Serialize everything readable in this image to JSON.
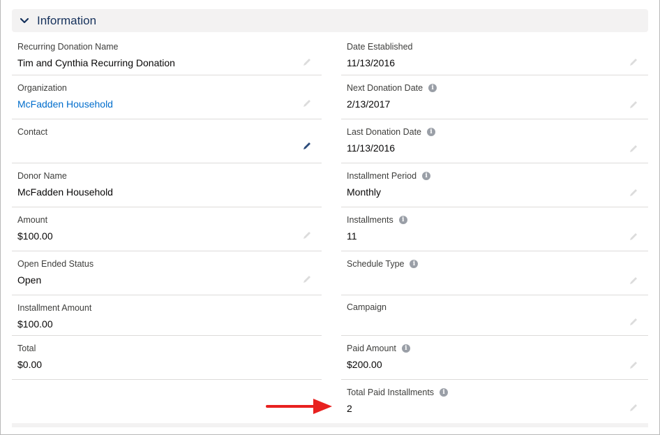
{
  "section": {
    "title": "Information",
    "icon": "chevron-down-icon"
  },
  "left_fields": [
    {
      "label": "Recurring Donation Name",
      "value": "Tim and Cynthia Recurring Donation",
      "link": false
    },
    {
      "label": "Organization",
      "value": "McFadden Household",
      "link": true
    },
    {
      "label": "Contact",
      "value": "",
      "link": false
    },
    {
      "label": "Donor Name",
      "value": "McFadden Household",
      "link": false
    },
    {
      "label": "Amount",
      "value": "$100.00",
      "link": false
    },
    {
      "label": "Open Ended Status",
      "value": "Open",
      "link": false
    },
    {
      "label": "Installment Amount",
      "value": "$100.00",
      "link": false
    },
    {
      "label": "Total",
      "value": "$0.00",
      "link": false
    }
  ],
  "right_fields": [
    {
      "label": "Date Established",
      "value": "11/13/2016",
      "info": false
    },
    {
      "label": "Next Donation Date",
      "value": "2/13/2017",
      "info": true
    },
    {
      "label": "Last Donation Date",
      "value": "11/13/2016",
      "info": true
    },
    {
      "label": "Installment Period",
      "value": "Monthly",
      "info": true
    },
    {
      "label": "Installments",
      "value": "11",
      "info": true
    },
    {
      "label": "Schedule Type",
      "value": "",
      "info": true
    },
    {
      "label": "Campaign",
      "value": "",
      "info": false
    },
    {
      "label": "Paid Amount",
      "value": "$200.00",
      "info": true
    },
    {
      "label": "Total Paid Installments",
      "value": "2",
      "info": true
    }
  ],
  "colors": {
    "arrow": "#e8211f",
    "link": "#006dcc",
    "pencil_active": "#54698d",
    "pencil_muted": "#dcdcdc"
  }
}
